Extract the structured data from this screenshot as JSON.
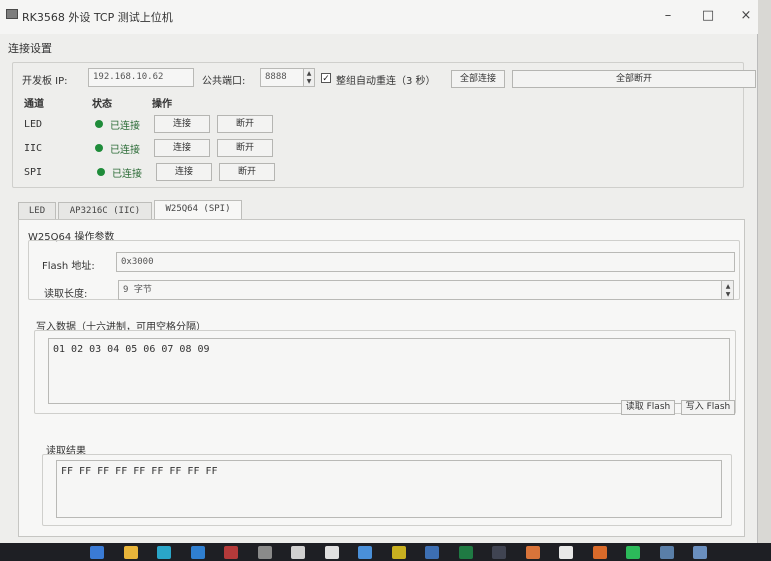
{
  "window": {
    "title": "RK3568 外设 TCP 测试上位机",
    "minimize": "–",
    "maximize": "□",
    "close": "×"
  },
  "connection": {
    "section_title": "连接设置",
    "ip_label": "开发板 IP:",
    "ip_value": "192.168.10.62",
    "port_label": "公共端口:",
    "port_value": "8888",
    "auto_reconnect_label": "整组自动重连（3 秒）",
    "auto_reconnect_checked": "✓",
    "connect_all": "全部连接",
    "disconnect_all": "全部断开",
    "headers": {
      "channel": "通道",
      "status": "状态",
      "action": "操作"
    },
    "channels": [
      {
        "name": "LED",
        "status": "已连接",
        "connect": "连接",
        "disconnect": "断开"
      },
      {
        "name": "IIC",
        "status": "已连接",
        "connect": "连接",
        "disconnect": "断开"
      },
      {
        "name": "SPI",
        "status": "已连接",
        "connect": "连接",
        "disconnect": "断开"
      }
    ],
    "status_color": "#1f8c3a"
  },
  "tabs": [
    {
      "label": "LED"
    },
    {
      "label": "AP3216C (IIC)"
    },
    {
      "label": "W25Q64 (SPI)"
    }
  ],
  "w25q64": {
    "params_title": "W25Q64 操作参数",
    "flash_addr_label": "Flash 地址:",
    "flash_addr_value": "0x3000",
    "read_len_label": "读取长度:",
    "read_len_value": "9 字节",
    "write_title": "写入数据（十六进制，可用空格分隔）",
    "write_value": "01 02 03 04 05 06 07 08 09",
    "read_flash_btn": "读取 Flash",
    "write_flash_btn": "写入 Flash",
    "read_result_title": "读取结果",
    "read_result_value": "FF FF FF FF FF FF FF FF FF"
  },
  "taskbar_icons": [
    {
      "name": "windows-start-icon",
      "color": "#3a7bd5"
    },
    {
      "name": "file-explorer-icon",
      "color": "#e8b53a"
    },
    {
      "name": "edge-browser-icon",
      "color": "#2aa6c9"
    },
    {
      "name": "vscode-icon",
      "color": "#2f7fd0"
    },
    {
      "name": "red-app-icon",
      "color": "#b43a3a"
    },
    {
      "name": "tool-app-icon",
      "color": "#8a8a8a"
    },
    {
      "name": "chatgpt-icon",
      "color": "#d0d0d0"
    },
    {
      "name": "spiral-app-icon",
      "color": "#e0e0e0"
    },
    {
      "name": "notepad-icon",
      "color": "#4a90d9"
    },
    {
      "name": "terminal-app-icon",
      "color": "#c8b020"
    },
    {
      "name": "phone-app-icon",
      "color": "#3d6fb3"
    },
    {
      "name": "excel-icon",
      "color": "#1f7a43"
    },
    {
      "name": "terminal-icon",
      "color": "#404452"
    },
    {
      "name": "orange-app-icon",
      "color": "#d9743a"
    },
    {
      "name": "typora-icon",
      "color": "#e8e8e8"
    },
    {
      "name": "grid-app-icon",
      "color": "#d86a2a"
    },
    {
      "name": "wechat-icon",
      "color": "#2cba5a"
    },
    {
      "name": "window-app-icon",
      "color": "#5a7fa8"
    },
    {
      "name": "remote-desktop-icon",
      "color": "#6a8fbf"
    }
  ]
}
